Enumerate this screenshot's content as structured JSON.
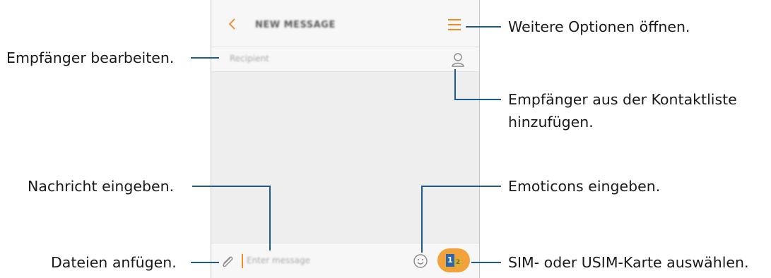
{
  "app": {
    "title": "NEW MESSAGE",
    "recipient_placeholder": "Recipient",
    "message_placeholder": "Enter message",
    "sim_labels": [
      "1",
      "2"
    ]
  },
  "callouts": {
    "options": "Weitere Optionen öffnen.",
    "edit_recipient": "Empfänger bearbeiten.",
    "add_from_contacts_1": "Empfänger aus der Kontaktliste",
    "add_from_contacts_2": "hinzufügen.",
    "enter_message": "Nachricht eingeben.",
    "emoticons": "Emoticons eingeben.",
    "attach_files": "Dateien anfügen.",
    "select_sim": "SIM- oder USIM-Karte auswählen."
  },
  "colors": {
    "accent": "#f08a24",
    "callout_line": "#1d5a8f",
    "sim_badge": "#f2a23a"
  },
  "icons": [
    "back-icon",
    "menu-icon",
    "contact-icon",
    "attach-icon",
    "emoticon-icon",
    "sim-icon"
  ]
}
